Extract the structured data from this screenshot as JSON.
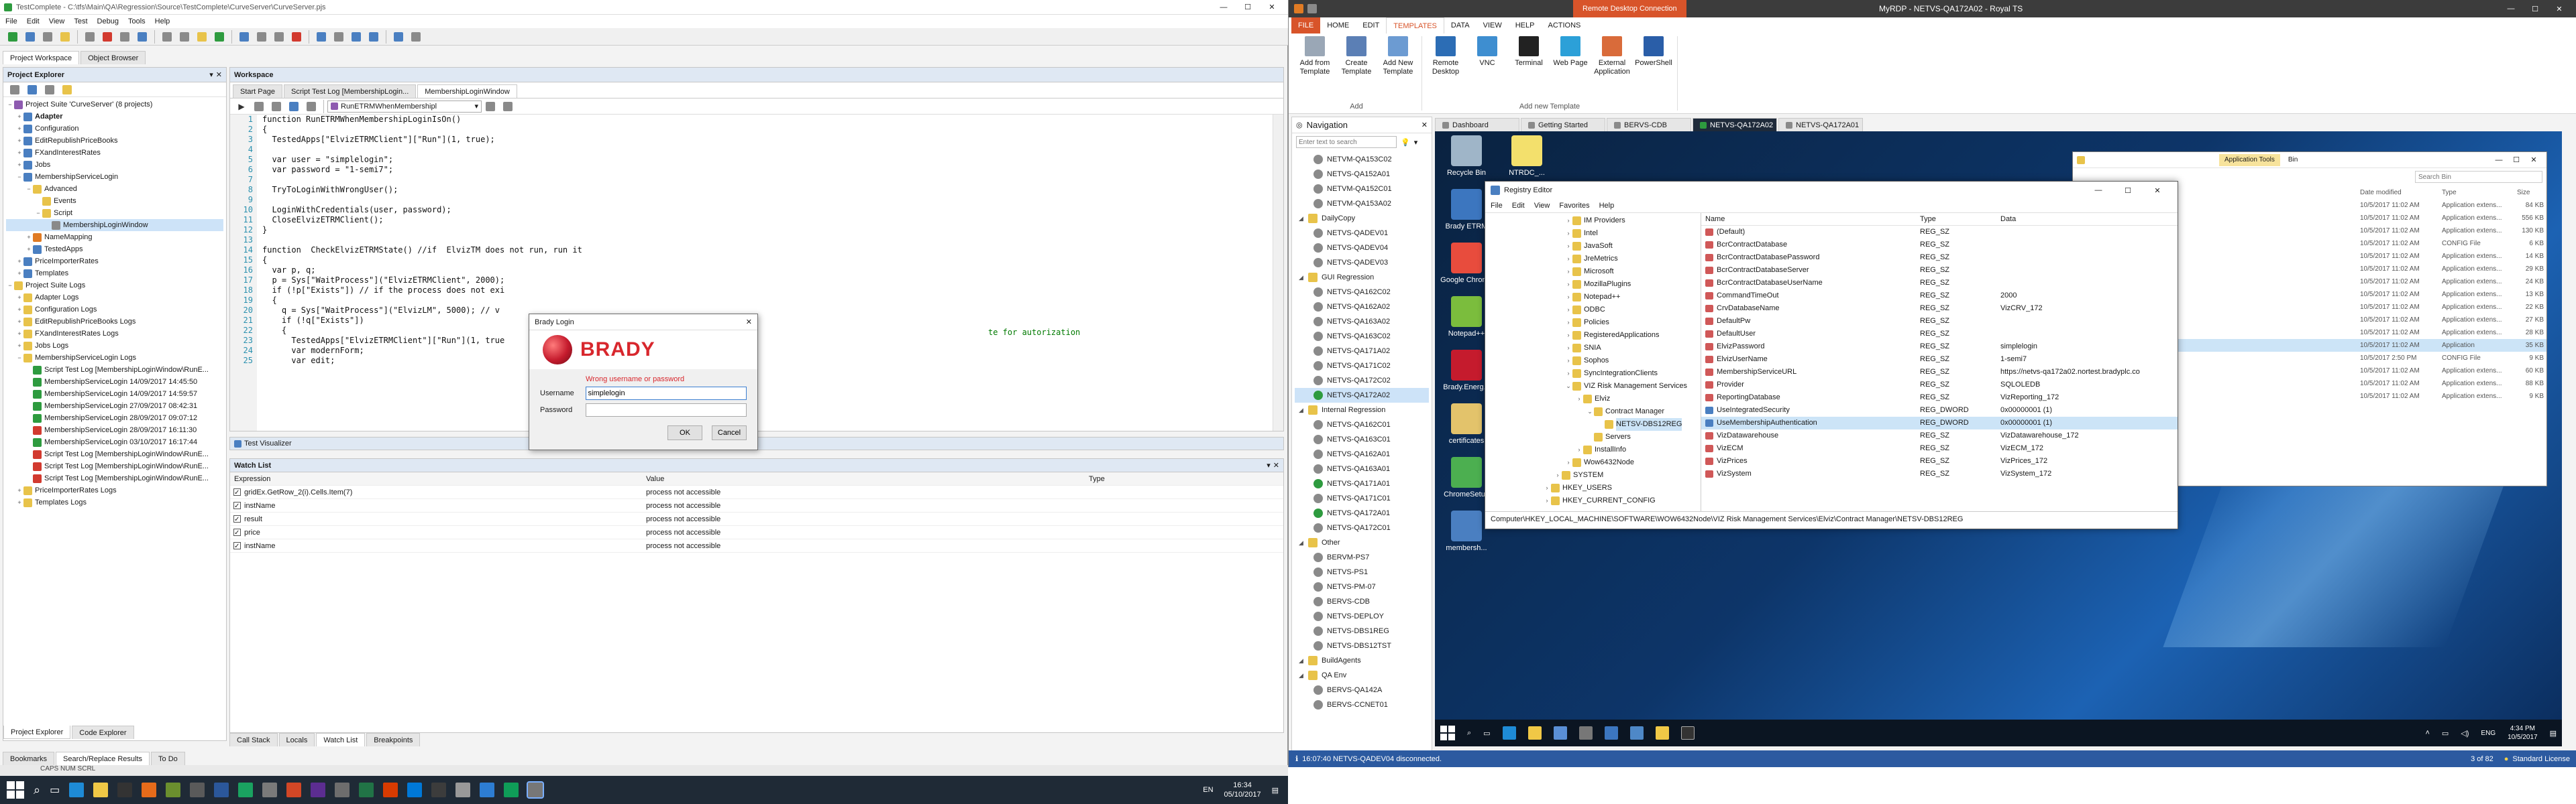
{
  "left": {
    "title": "TestComplete - C:\\tfs\\Main\\QA\\Regression\\Source\\TestComplete\\CurveServer\\CurveServer.pjs",
    "menu": [
      "File",
      "Edit",
      "View",
      "Test",
      "Debug",
      "Tools",
      "Help"
    ],
    "main_tabs": [
      "Project Workspace",
      "Object Browser"
    ],
    "project_explorer": {
      "title": "Project Explorer",
      "nodes": [
        {
          "label": "Project Suite 'CurveServer' (8 projects)",
          "depth": 0,
          "exp": "−",
          "c": "f-p"
        },
        {
          "label": "Adapter",
          "depth": 1,
          "exp": "+",
          "c": "f-b",
          "bold": true
        },
        {
          "label": "Configuration",
          "depth": 1,
          "exp": "+",
          "c": "f-b"
        },
        {
          "label": "EditRepublishPriceBooks",
          "depth": 1,
          "exp": "+",
          "c": "f-b"
        },
        {
          "label": "FXandInterestRates",
          "depth": 1,
          "exp": "+",
          "c": "f-b"
        },
        {
          "label": "Jobs",
          "depth": 1,
          "exp": "+",
          "c": "f-b"
        },
        {
          "label": "MembershipServiceLogin",
          "depth": 1,
          "exp": "−",
          "c": "f-b"
        },
        {
          "label": "Advanced",
          "depth": 2,
          "exp": "−",
          "c": "f-y"
        },
        {
          "label": "Events",
          "depth": 3,
          "exp": "",
          "c": "f-y"
        },
        {
          "label": "Script",
          "depth": 3,
          "exp": "−",
          "c": "f-y"
        },
        {
          "label": "MembershipLoginWindow",
          "depth": 4,
          "exp": "",
          "c": "f-gr",
          "sel": true
        },
        {
          "label": "NameMapping",
          "depth": 2,
          "exp": "+",
          "c": "f-o"
        },
        {
          "label": "TestedApps",
          "depth": 2,
          "exp": "+",
          "c": "f-b"
        },
        {
          "label": "PriceImporterRates",
          "depth": 1,
          "exp": "+",
          "c": "f-b"
        },
        {
          "label": "Templates",
          "depth": 1,
          "exp": "+",
          "c": "f-b"
        },
        {
          "label": "Project Suite Logs",
          "depth": 0,
          "exp": "−",
          "c": "f-y"
        },
        {
          "label": "Adapter Logs",
          "depth": 1,
          "exp": "+",
          "c": "f-y"
        },
        {
          "label": "Configuration Logs",
          "depth": 1,
          "exp": "+",
          "c": "f-y"
        },
        {
          "label": "EditRepublishPriceBooks Logs",
          "depth": 1,
          "exp": "+",
          "c": "f-y"
        },
        {
          "label": "FXandInterestRates Logs",
          "depth": 1,
          "exp": "+",
          "c": "f-y"
        },
        {
          "label": "Jobs Logs",
          "depth": 1,
          "exp": "+",
          "c": "f-y"
        },
        {
          "label": "MembershipServiceLogin Logs",
          "depth": 1,
          "exp": "−",
          "c": "f-y"
        },
        {
          "label": "Script Test Log [MembershipLoginWindow\\RunE...",
          "depth": 2,
          "exp": "",
          "c": "f-g"
        },
        {
          "label": "MembershipServiceLogin 14/09/2017 14:45:50",
          "depth": 2,
          "exp": "",
          "c": "f-g"
        },
        {
          "label": "MembershipServiceLogin 14/09/2017 14:59:57",
          "depth": 2,
          "exp": "",
          "c": "f-g"
        },
        {
          "label": "MembershipServiceLogin 27/09/2017 08:42:31",
          "depth": 2,
          "exp": "",
          "c": "f-g"
        },
        {
          "label": "MembershipServiceLogin 28/09/2017 09:07:12",
          "depth": 2,
          "exp": "",
          "c": "f-g"
        },
        {
          "label": "MembershipServiceLogin 28/09/2017 16:11:30",
          "depth": 2,
          "exp": "",
          "c": "f-r"
        },
        {
          "label": "MembershipServiceLogin 03/10/2017 16:17:44",
          "depth": 2,
          "exp": "",
          "c": "f-g"
        },
        {
          "label": "Script Test Log [MembershipLoginWindow\\RunE...",
          "depth": 2,
          "exp": "",
          "c": "f-r"
        },
        {
          "label": "Script Test Log [MembershipLoginWindow\\RunE...",
          "depth": 2,
          "exp": "",
          "c": "f-r"
        },
        {
          "label": "Script Test Log [MembershipLoginWindow\\RunE...",
          "depth": 2,
          "exp": "",
          "c": "f-r"
        },
        {
          "label": "PriceImporterRates Logs",
          "depth": 1,
          "exp": "+",
          "c": "f-y"
        },
        {
          "label": "Templates Logs",
          "depth": 1,
          "exp": "+",
          "c": "f-y"
        }
      ],
      "bottom_tabs": [
        "Project Explorer",
        "Code Explorer"
      ]
    },
    "workspace": {
      "title": "Workspace",
      "tabs": [
        "Start Page",
        "Script Test Log [MembershipLogin...",
        "MembershipLoginWindow"
      ],
      "routine_select": "RunETRMWhenMembershipl",
      "lines": [
        "function RunETRMWhenMembershipLoginIsOn()",
        "{",
        "  TestedApps[\"ElvizETRMClient\"][\"Run\"](1, true);",
        "",
        "  var user = \"simplelogin\";",
        "  var password = \"1-semi7\";",
        "",
        "  TryToLoginWithWrongUser();",
        "",
        "  LoginWithCredentials(user, password);",
        "  CloseElvizETRMClient();",
        "}",
        "",
        "function  CheckElvizETRMState() //if  ElvizTM does not run, run it",
        "{",
        "  var p, q;",
        "  p = Sys[\"WaitProcess\"](\"ElvizETRMClient\", 2000);",
        "  if (!p[\"Exists\"]) // if the process does not exi",
        "  {",
        "    q = Sys[\"WaitProcess\"](\"ElvizLM\", 5000); // v",
        "    if (!q[\"Exists\"])",
        "    {",
        "      TestedApps[\"ElvizETRMClient\"][\"Run\"](1, true",
        "      var modernForm;",
        "      var edit;"
      ],
      "overflow_comment": "te for autorization"
    },
    "test_visualizer": "Test Visualizer",
    "watch": {
      "title": "Watch List",
      "headers": [
        "Expression",
        "Value",
        "Type"
      ],
      "rows": [
        {
          "expr": "gridEx.GetRow_2(i).Cells.Item(7)",
          "value": "process not accessible"
        },
        {
          "expr": "instName",
          "value": "process not accessible"
        },
        {
          "expr": "result",
          "value": "process not accessible"
        },
        {
          "expr": "price",
          "value": "process not accessible"
        },
        {
          "expr": "instName",
          "value": "process not accessible"
        }
      ],
      "bottom_tabs": [
        "Call Stack",
        "Locals",
        "Watch List",
        "Breakpoints"
      ]
    },
    "bottom_tabs": [
      "Bookmarks",
      "Search/Replace Results",
      "To Do"
    ],
    "status": "CAPS  NUM  SCRL"
  },
  "login": {
    "title": "Brady Login",
    "brand": "BRADY",
    "error": "Wrong username or password",
    "username_label": "Username",
    "username_value": "simplelogin",
    "password_label": "Password",
    "ok": "OK",
    "cancel": "Cancel"
  },
  "right": {
    "title": "MyRDP - NETVS-QA172A02 - Royal TS",
    "contextual_group": "Remote Desktop Connection",
    "ribbon_tabs": [
      "FILE",
      "HOME",
      "EDIT",
      "TEMPLATES",
      "DATA",
      "VIEW",
      "HELP",
      "ACTIONS"
    ],
    "ribbon_groups": [
      {
        "name": "Add",
        "buttons": [
          "Add from Template",
          "Create Template",
          "Add New Template"
        ]
      },
      {
        "name": "Add new Template",
        "buttons": [
          "Remote Desktop",
          "VNC",
          "Terminal",
          "Web Page",
          "External Application",
          "PowerShell"
        ]
      }
    ],
    "nav": {
      "title": "Navigation",
      "search_placeholder": "Enter text to search",
      "items": [
        {
          "label": "NETVM-QA153C02",
          "depth": 1,
          "c": "f-gr"
        },
        {
          "label": "NETVS-QA152A01",
          "depth": 1,
          "c": "f-gr"
        },
        {
          "label": "NETVM-QA152C01",
          "depth": 1,
          "c": "f-gr"
        },
        {
          "label": "NETVM-QA153A02",
          "depth": 1,
          "c": "f-gr"
        },
        {
          "label": "DailyCopy",
          "depth": 0,
          "c": "f-y"
        },
        {
          "label": "NETVS-QADEV01",
          "depth": 1,
          "c": "f-gr"
        },
        {
          "label": "NETVS-QADEV04",
          "depth": 1,
          "c": "f-gr"
        },
        {
          "label": "NETVS-QADEV03",
          "depth": 1,
          "c": "f-gr"
        },
        {
          "label": "GUI Regression",
          "depth": 0,
          "c": "f-y"
        },
        {
          "label": "NETVS-QA162C02",
          "depth": 1,
          "c": "f-gr"
        },
        {
          "label": "NETVS-QA162A02",
          "depth": 1,
          "c": "f-gr"
        },
        {
          "label": "NETVS-QA163A02",
          "depth": 1,
          "c": "f-gr"
        },
        {
          "label": "NETVS-QA163C02",
          "depth": 1,
          "c": "f-gr"
        },
        {
          "label": "NETVS-QA171A02",
          "depth": 1,
          "c": "f-gr"
        },
        {
          "label": "NETVS-QA171C02",
          "depth": 1,
          "c": "f-gr"
        },
        {
          "label": "NETVS-QA172C02",
          "depth": 1,
          "c": "f-gr"
        },
        {
          "label": "NETVS-QA172A02",
          "depth": 1,
          "c": "f-g",
          "sel": true
        },
        {
          "label": "Internal Regression",
          "depth": 0,
          "c": "f-y"
        },
        {
          "label": "NETVS-QA162C01",
          "depth": 1,
          "c": "f-gr"
        },
        {
          "label": "NETVS-QA163C01",
          "depth": 1,
          "c": "f-gr"
        },
        {
          "label": "NETVS-QA162A01",
          "depth": 1,
          "c": "f-gr"
        },
        {
          "label": "NETVS-QA163A01",
          "depth": 1,
          "c": "f-gr"
        },
        {
          "label": "NETVS-QA171A01",
          "depth": 1,
          "c": "f-g"
        },
        {
          "label": "NETVS-QA171C01",
          "depth": 1,
          "c": "f-gr"
        },
        {
          "label": "NETVS-QA172A01",
          "depth": 1,
          "c": "f-g"
        },
        {
          "label": "NETVS-QA172C01",
          "depth": 1,
          "c": "f-gr"
        },
        {
          "label": "Other",
          "depth": 0,
          "c": "f-y"
        },
        {
          "label": "BERVM-PS7",
          "depth": 1,
          "c": "f-gr"
        },
        {
          "label": "NETVS-PS1",
          "depth": 1,
          "c": "f-gr"
        },
        {
          "label": "NETVS-PM-07",
          "depth": 1,
          "c": "f-gr"
        },
        {
          "label": "BERVS-CDB",
          "depth": 1,
          "c": "f-gr"
        },
        {
          "label": "NETVS-DEPLOY",
          "depth": 1,
          "c": "f-gr"
        },
        {
          "label": "NETVS-DBS1REG",
          "depth": 1,
          "c": "f-gr"
        },
        {
          "label": "NETVS-DBS12TST",
          "depth": 1,
          "c": "f-gr"
        },
        {
          "label": "BuildAgents",
          "depth": 0,
          "c": "f-y"
        },
        {
          "label": "QA Env",
          "depth": 0,
          "c": "f-y"
        },
        {
          "label": "BERVS-QA142A",
          "depth": 1,
          "c": "f-gr"
        },
        {
          "label": "BERVS-CCNET01",
          "depth": 1,
          "c": "f-gr"
        }
      ]
    },
    "session_tabs": [
      "Dashboard",
      "Getting Started",
      "BERVS-CDB",
      "NETVS-QA172A02",
      "NETVS-QA172A01"
    ],
    "status": "16:07:40 NETVS-QADEV04 disconnected.",
    "status_right": "3 of 82",
    "license": "Standard License"
  },
  "remote": {
    "desktop_icons": [
      "Recycle Bin",
      "NTRDC_...",
      "Brady ETRM",
      "Google Chrome",
      "Notepad++",
      "Brady.Energ...",
      "certificates",
      "ChromeSetup",
      "membersh..."
    ],
    "regedit": {
      "title": "Registry Editor",
      "menu": [
        "File",
        "Edit",
        "View",
        "Favorites",
        "Help"
      ],
      "tree": [
        {
          "label": "IM Providers",
          "depth": 3
        },
        {
          "label": "Intel",
          "depth": 3
        },
        {
          "label": "JavaSoft",
          "depth": 3
        },
        {
          "label": "JreMetrics",
          "depth": 3
        },
        {
          "label": "Microsoft",
          "depth": 3
        },
        {
          "label": "MozillaPlugins",
          "depth": 3
        },
        {
          "label": "Notepad++",
          "depth": 3
        },
        {
          "label": "ODBC",
          "depth": 3
        },
        {
          "label": "Policies",
          "depth": 3
        },
        {
          "label": "RegisteredApplications",
          "depth": 3
        },
        {
          "label": "SNIA",
          "depth": 3
        },
        {
          "label": "Sophos",
          "depth": 3
        },
        {
          "label": "SyncIntegrationClients",
          "depth": 3
        },
        {
          "label": "VIZ Risk Management Services",
          "depth": 3
        },
        {
          "label": "Elviz",
          "depth": 4
        },
        {
          "label": "Contract Manager",
          "depth": 5
        },
        {
          "label": "NETSV-DBS12REG",
          "depth": 6,
          "sel": true
        },
        {
          "label": "Servers",
          "depth": 5
        },
        {
          "label": "InstallInfo",
          "depth": 4
        },
        {
          "label": "Wow6432Node",
          "depth": 3
        },
        {
          "label": "SYSTEM",
          "depth": 2
        },
        {
          "label": "HKEY_USERS",
          "depth": 1
        },
        {
          "label": "HKEY_CURRENT_CONFIG",
          "depth": 1
        }
      ],
      "headers": [
        "Name",
        "Type",
        "Data"
      ],
      "values": [
        {
          "name": "(Default)",
          "type": "REG_SZ",
          "data": ""
        },
        {
          "name": "BcrContractDatabase",
          "type": "REG_SZ",
          "data": ""
        },
        {
          "name": "BcrContractDatabasePassword",
          "type": "REG_SZ",
          "data": ""
        },
        {
          "name": "BcrContractDatabaseServer",
          "type": "REG_SZ",
          "data": ""
        },
        {
          "name": "BcrContractDatabaseUserName",
          "type": "REG_SZ",
          "data": ""
        },
        {
          "name": "CommandTimeOut",
          "type": "REG_SZ",
          "data": "2000"
        },
        {
          "name": "CrvDatabaseName",
          "type": "REG_SZ",
          "data": "VizCRV_172"
        },
        {
          "name": "DefaultPw",
          "type": "REG_SZ",
          "data": ""
        },
        {
          "name": "DefaultUser",
          "type": "REG_SZ",
          "data": ""
        },
        {
          "name": "ElvizPassword",
          "type": "REG_SZ",
          "data": "simplelogin"
        },
        {
          "name": "ElvizUserName",
          "type": "REG_SZ",
          "data": "1-semi7"
        },
        {
          "name": "MembershipServiceURL",
          "type": "REG_SZ",
          "data": "https://netvs-qa172a02.nortest.bradyplc.co"
        },
        {
          "name": "Provider",
          "type": "REG_SZ",
          "data": "SQLOLEDB"
        },
        {
          "name": "ReportingDatabase",
          "type": "REG_SZ",
          "data": "VizReporting_172"
        },
        {
          "name": "UseIntegratedSecurity",
          "type": "REG_DWORD",
          "data": "0x00000001 (1)"
        },
        {
          "name": "UseMembershipAuthentication",
          "type": "REG_DWORD",
          "data": "0x00000001 (1)",
          "sel": true
        },
        {
          "name": "VizDatawarehouse",
          "type": "REG_SZ",
          "data": "VizDatawarehouse_172"
        },
        {
          "name": "VizECM",
          "type": "REG_SZ",
          "data": "VizECM_172"
        },
        {
          "name": "VizPrices",
          "type": "REG_SZ",
          "data": "VizPrices_172"
        },
        {
          "name": "VizSystem",
          "type": "REG_SZ",
          "data": "VizSystem_172"
        }
      ],
      "address": "Computer\\HKEY_LOCAL_MACHINE\\SOFTWARE\\WOW6432Node\\VIZ Risk Management Services\\Elviz\\Contract Manager\\NETSV-DBS12REG"
    },
    "explorer": {
      "ribbon_tab": "Application Tools",
      "ribbon_tab2": "Bin",
      "search": "Search Bin",
      "headers": [
        "Date modified",
        "Type",
        "Size"
      ],
      "rows": [
        {
          "date": "10/5/2017 11:02 AM",
          "type": "Application extens...",
          "size": "84 KB"
        },
        {
          "date": "10/5/2017 11:02 AM",
          "type": "Application extens...",
          "size": "556 KB"
        },
        {
          "date": "10/5/2017 11:02 AM",
          "type": "Application extens...",
          "size": "130 KB"
        },
        {
          "date": "10/5/2017 11:02 AM",
          "type": "CONFIG File",
          "size": "6 KB"
        },
        {
          "date": "10/5/2017 11:02 AM",
          "type": "Application extens...",
          "size": "14 KB"
        },
        {
          "date": "10/5/2017 11:02 AM",
          "type": "Application extens...",
          "size": "29 KB"
        },
        {
          "date": "10/5/2017 11:02 AM",
          "type": "Application extens...",
          "size": "24 KB"
        },
        {
          "date": "10/5/2017 11:02 AM",
          "type": "Application extens...",
          "size": "13 KB"
        },
        {
          "date": "10/5/2017 11:02 AM",
          "type": "Application extens...",
          "size": "22 KB"
        },
        {
          "date": "10/5/2017 11:02 AM",
          "type": "Application extens...",
          "size": "27 KB"
        },
        {
          "date": "10/5/2017 11:02 AM",
          "type": "Application extens...",
          "size": "28 KB"
        },
        {
          "date": "10/5/2017 11:02 AM",
          "type": "Application",
          "size": "35 KB"
        },
        {
          "date": "10/5/2017 2:50 PM",
          "type": "CONFIG File",
          "size": "9 KB"
        },
        {
          "date": "10/5/2017 11:02 AM",
          "type": "Application extens...",
          "size": "60 KB"
        },
        {
          "date": "10/5/2017 11:02 AM",
          "type": "Application extens...",
          "size": "88 KB"
        },
        {
          "date": "10/5/2017 11:02 AM",
          "type": "Application extens...",
          "size": "9 KB"
        }
      ]
    },
    "clock_time": "4:34 PM",
    "clock_date": "10/5/2017",
    "lang": "ENG"
  },
  "host_taskbar": {
    "lang": "EN",
    "time": "16:34",
    "date": "05/10/2017"
  }
}
